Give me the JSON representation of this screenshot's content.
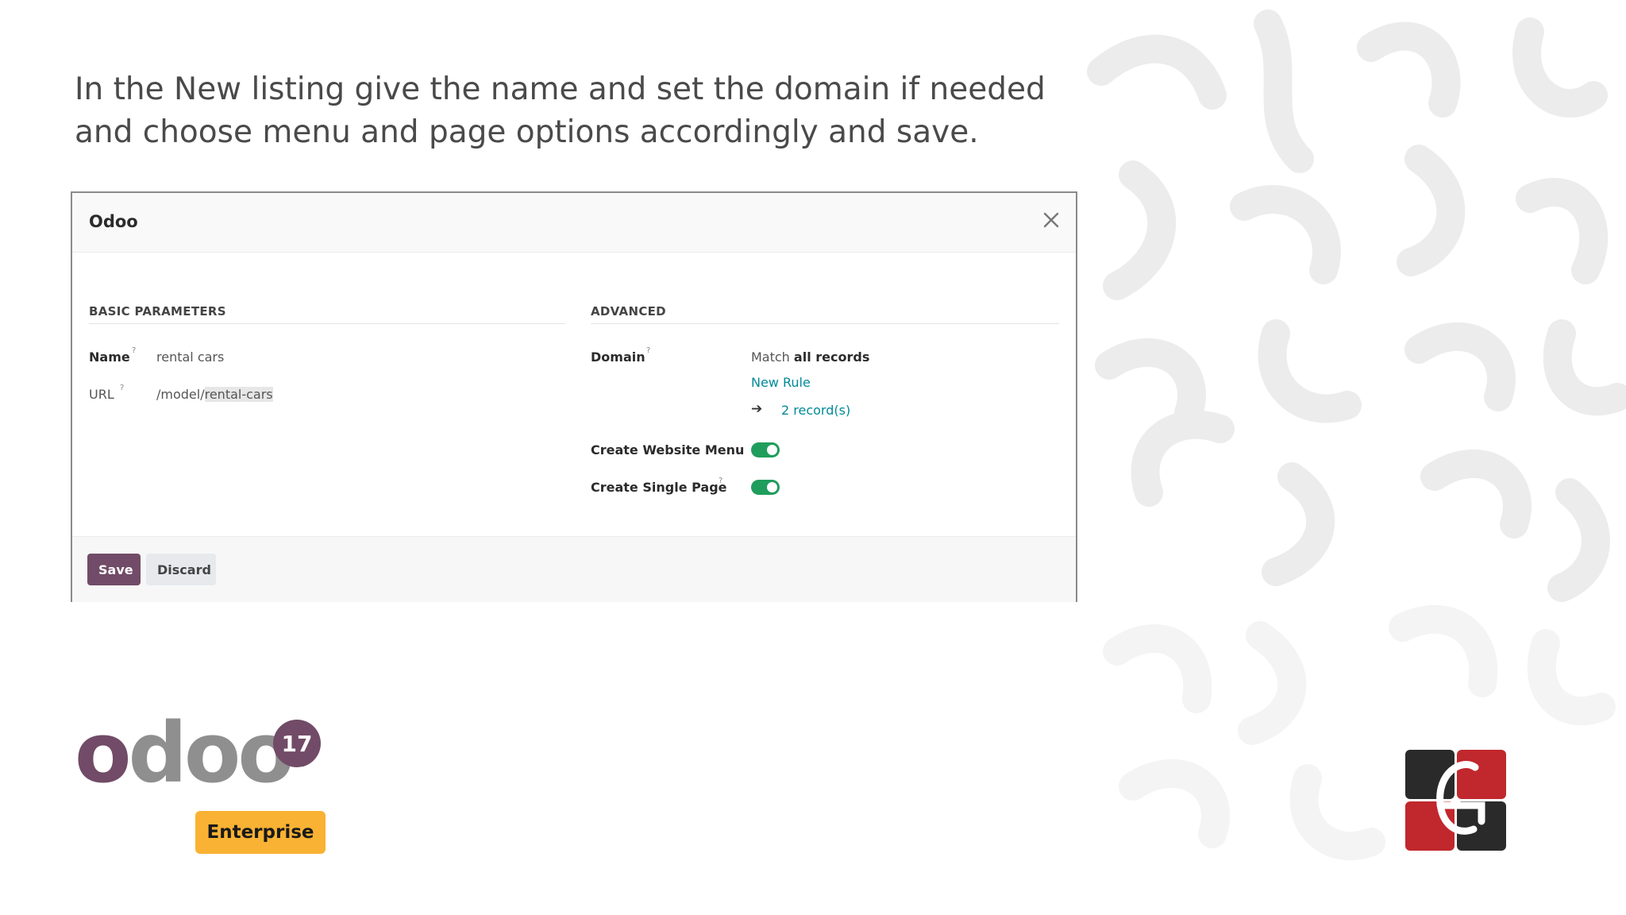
{
  "instruction": {
    "line1": "In the New listing give the name and set the domain if needed",
    "line2": "and choose menu and page options accordingly and save."
  },
  "dialog": {
    "title": "Odoo",
    "close_icon": "close-icon",
    "basic": {
      "section_title": "BASIC PARAMETERS",
      "name_label": "Name",
      "name_value": "rental cars",
      "url_label": "URL",
      "url_prefix": "/model/",
      "url_slug": "rental-cars",
      "help_mark": "?"
    },
    "advanced": {
      "section_title": "ADVANCED",
      "domain_label": "Domain",
      "domain_match_prefix": "Match",
      "domain_match_bold": "all records",
      "new_rule_link": "New Rule",
      "records_link": "2 record(s)",
      "arrow_icon": "arrow-right-icon",
      "website_menu_label": "Create Website Menu",
      "website_menu_enabled": true,
      "single_page_label": "Create Single Page",
      "single_page_enabled": true
    },
    "footer": {
      "save_label": "Save",
      "discard_label": "Discard"
    }
  },
  "branding": {
    "odoo_first": "o",
    "odoo_rest": "doo",
    "version": "17",
    "edition": "Enterprise"
  },
  "colors": {
    "odoo_purple": "#714b67",
    "toggle_green": "#1f9d5c",
    "link_teal": "#018a9a",
    "enterprise_yellow": "#f9b233",
    "logo_red": "#c0282d",
    "logo_dark": "#2a2a2a"
  }
}
